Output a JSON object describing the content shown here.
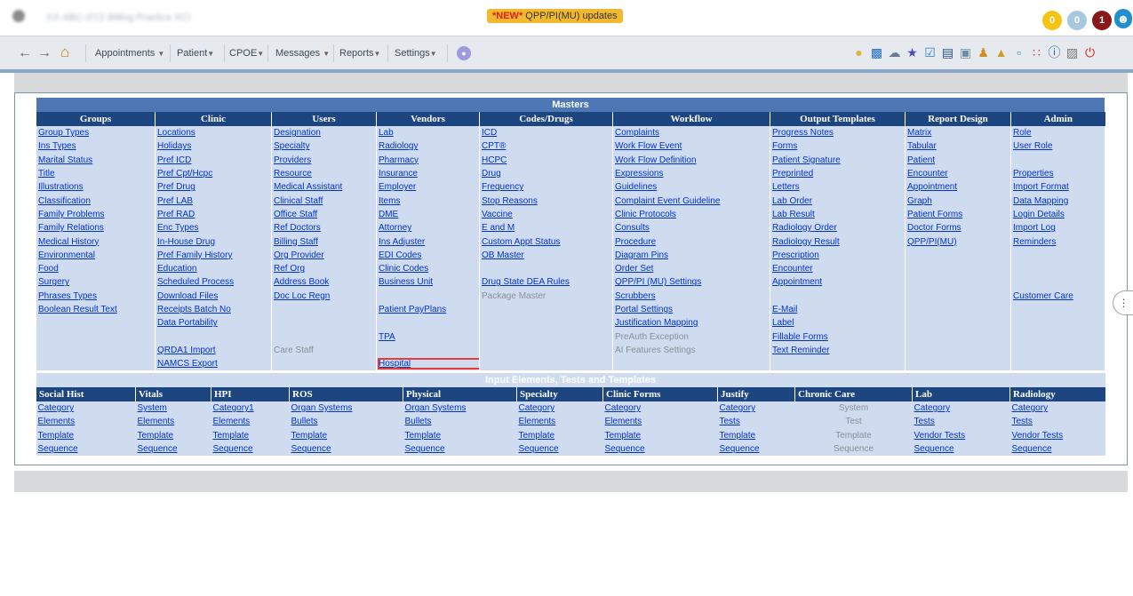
{
  "header": {
    "practice_name": "XX-ABC-XYZ Billing Practice XCl",
    "banner_new": "*NEW*",
    "banner_text": "QPP/PI(MU) updates",
    "counter_yellow": "0",
    "counter_blue": "0",
    "counter_red": "1"
  },
  "nav": {
    "menus": [
      "Appointments",
      "Patient",
      "CPOE",
      "Messages",
      "Reports",
      "Settings"
    ]
  },
  "masters": {
    "caption": "Masters",
    "columns": [
      "Groups",
      "Clinic",
      "Users",
      "Vendors",
      "Codes/Drugs",
      "Workflow",
      "Output Templates",
      "Report Design",
      "Admin"
    ],
    "rows": [
      [
        "Group Types",
        "Locations",
        "Designation",
        "Lab",
        "ICD",
        "Complaints",
        "Progress Notes",
        "Matrix",
        "Role"
      ],
      [
        "Ins Types",
        "Holidays",
        "Specialty",
        "Radiology",
        "CPT®",
        "Work Flow Event",
        "Forms",
        "Tabular",
        "User Role"
      ],
      [
        "Marital Status",
        "Pref ICD",
        "Providers",
        "Pharmacy",
        "HCPC",
        "Work Flow Definition",
        "Patient Signature",
        "Patient",
        ""
      ],
      [
        "Title",
        "Pref Cpt/Hcpc",
        "Resource",
        "Insurance",
        "Drug",
        "Expressions",
        "Preprinted",
        "Encounter",
        "Properties"
      ],
      [
        "Illustrations",
        "Pref Drug",
        "Medical Assistant",
        "Employer",
        "Frequency",
        "Guidelines",
        "Letters",
        "Appointment",
        "Import Format"
      ],
      [
        "Classification",
        "Pref LAB",
        "Clinical Staff",
        "Items",
        "Stop Reasons",
        "Complaint Event Guideline",
        "Lab Order",
        "Graph",
        "Data Mapping"
      ],
      [
        "Family Problems",
        "Pref RAD",
        "Office Staff",
        "DME",
        "Vaccine",
        "Clinic Protocols",
        "Lab Result",
        "Patient Forms",
        "Login Details"
      ],
      [
        "Family Relations",
        "Enc Types",
        "Ref Doctors",
        "Attorney",
        "E and M",
        "Consults",
        "Radiology Order",
        "Doctor Forms",
        "Import Log"
      ],
      [
        "Medical History",
        "In-House Drug",
        "Billing Staff",
        "Ins Adjuster",
        "Custom Appt Status",
        "Procedure",
        "Radiology Result",
        "QPP/PI(MU)",
        "Reminders"
      ],
      [
        "Environmental",
        "Pref Family History",
        "Org Provider",
        "EDI Codes",
        "OB Master",
        "Diagram Pins",
        "Prescription",
        "",
        ""
      ],
      [
        "Food",
        "Education",
        "Ref Org",
        "Clinic Codes",
        "",
        "Order Set",
        "Encounter",
        "",
        ""
      ],
      [
        "Surgery",
        "Scheduled Process",
        "Address Book",
        "Business Unit",
        "Drug State DEA Rules",
        "QPP/PI (MU) Settings",
        "Appointment",
        "",
        ""
      ],
      [
        "Phrases Types",
        "Download Files",
        "Doc Loc Regn",
        "",
        "Package Master",
        "Scrubbers",
        "",
        "",
        "Customer Care"
      ],
      [
        "Boolean Result Text",
        "Receipts Batch No",
        "",
        "Patient PayPlans",
        "",
        "Portal Settings",
        "E-Mail",
        "",
        ""
      ],
      [
        "",
        "Data Portability",
        "",
        "",
        "",
        "Justification Mapping",
        "Label",
        "",
        ""
      ],
      [
        "",
        "",
        "",
        "TPA",
        "",
        "PreAuth Exception",
        "Fillable Forms",
        "",
        ""
      ],
      [
        "",
        "QRDA1 Import",
        "Care Staff",
        "",
        "",
        "AI Features Settings",
        "Text Reminder",
        "",
        ""
      ],
      [
        "",
        "NAMCS Export",
        "",
        "Hospital",
        "",
        "",
        "",
        "",
        ""
      ]
    ],
    "disabled": [
      "Package Master",
      "Care Staff",
      "PreAuth Exception",
      "AI Features Settings"
    ],
    "highlighted": "Hospital"
  },
  "inputs": {
    "caption": "Input Elements, Tests and Templates",
    "columns": [
      "Social Hist",
      "Vitals",
      "HPI",
      "ROS",
      "Physical",
      "Specialty",
      "Clinic Forms",
      "Justify",
      "Chronic Care",
      "Lab",
      "Radiology"
    ],
    "rows": [
      [
        "Category",
        "System",
        "Category1",
        "Organ Systems",
        "Organ Systems",
        "Category",
        "Category",
        "Category",
        "System",
        "Category",
        "Category"
      ],
      [
        "Elements",
        "Elements",
        "Elements",
        "Bullets",
        "Bullets",
        "Elements",
        "Elements",
        "Tests",
        "Test",
        "Tests",
        "Tests"
      ],
      [
        "Template",
        "Template",
        "Template",
        "Template",
        "Template",
        "Template",
        "Template",
        "Template",
        "Template",
        "Vendor Tests",
        "Vendor Tests"
      ],
      [
        "Sequence",
        "Sequence",
        "Sequence",
        "Sequence",
        "Sequence",
        "Sequence",
        "Sequence",
        "Sequence",
        "Sequence",
        "Sequence",
        "Sequence"
      ]
    ],
    "disabled_column": 8
  }
}
